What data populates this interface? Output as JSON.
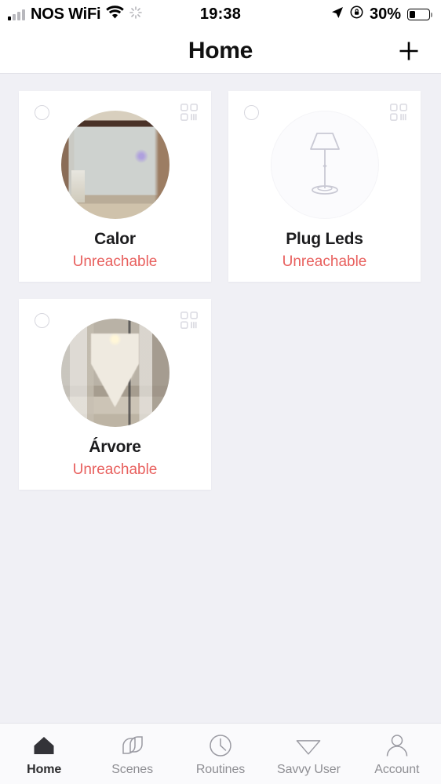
{
  "status_bar": {
    "carrier": "NOS WiFi",
    "time": "19:38",
    "battery_percent": "30%",
    "battery_level": 30,
    "icons": [
      "signal-bars-icon",
      "wifi-icon",
      "spinner-icon",
      "location-arrow-icon",
      "rotation-lock-icon",
      "battery-icon"
    ]
  },
  "navbar": {
    "title": "Home",
    "add_label": "+"
  },
  "devices": [
    {
      "name": "Calor",
      "status": "Unreachable",
      "thumb_type": "photo",
      "photo_class": "photo-calor",
      "selected": false
    },
    {
      "name": "Plug Leds",
      "status": "Unreachable",
      "thumb_type": "icon",
      "icon": "floor-lamp-icon",
      "selected": false
    },
    {
      "name": "Árvore",
      "status": "Unreachable",
      "thumb_type": "photo",
      "photo_class": "photo-arvore",
      "selected": false
    }
  ],
  "tabs": [
    {
      "label": "Home",
      "icon": "house-icon",
      "active": true
    },
    {
      "label": "Scenes",
      "icon": "overlapping-shapes-icon",
      "active": false
    },
    {
      "label": "Routines",
      "icon": "clock-icon",
      "active": false
    },
    {
      "label": "Savvy User",
      "icon": "diamond-icon",
      "active": false
    },
    {
      "label": "Account",
      "icon": "person-icon",
      "active": false
    }
  ],
  "colors": {
    "background": "#f0f0f5",
    "card": "#ffffff",
    "status_red": "#e8605e",
    "tab_inactive": "#8e8e93",
    "tab_active": "#2c2c2e"
  }
}
